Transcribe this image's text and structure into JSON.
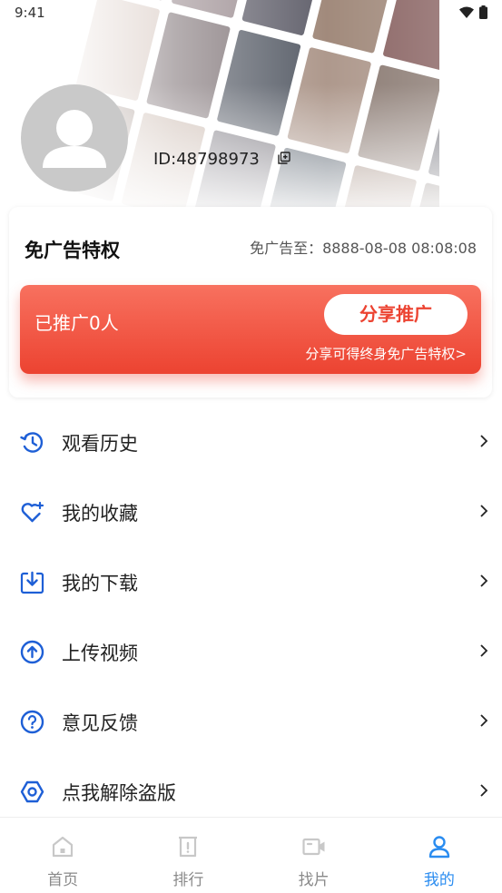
{
  "status_bar": {
    "time": "9:41"
  },
  "profile": {
    "user_id": "ID:48798973"
  },
  "vip": {
    "title": "免广告特权",
    "expire": "免广告至：8888-08-08 08:08:08",
    "promoted_count": "已推广0人",
    "share_button": "分享推广",
    "share_hint": "分享可得终身免广告特权>"
  },
  "menu": [
    {
      "label": "观看历史",
      "icon": "history-icon"
    },
    {
      "label": "我的收藏",
      "icon": "heart-icon"
    },
    {
      "label": "我的下载",
      "icon": "download-icon"
    },
    {
      "label": "上传视频",
      "icon": "upload-icon"
    },
    {
      "label": "意见反馈",
      "icon": "question-icon"
    },
    {
      "label": "点我解除盗版",
      "icon": "hexagon-nut-icon"
    }
  ],
  "nav": [
    {
      "label": "首页",
      "icon": "home-icon",
      "active": false
    },
    {
      "label": "排行",
      "icon": "ranking-icon",
      "active": false
    },
    {
      "label": "找片",
      "icon": "video-camera-icon",
      "active": false
    },
    {
      "label": "我的",
      "icon": "user-icon",
      "active": true
    }
  ],
  "colors": {
    "accent": "#2a8cf0",
    "menu_icon": "#1e5fd6",
    "promo_red": "#ec4331",
    "inactive_nav": "#c8c8c8"
  }
}
